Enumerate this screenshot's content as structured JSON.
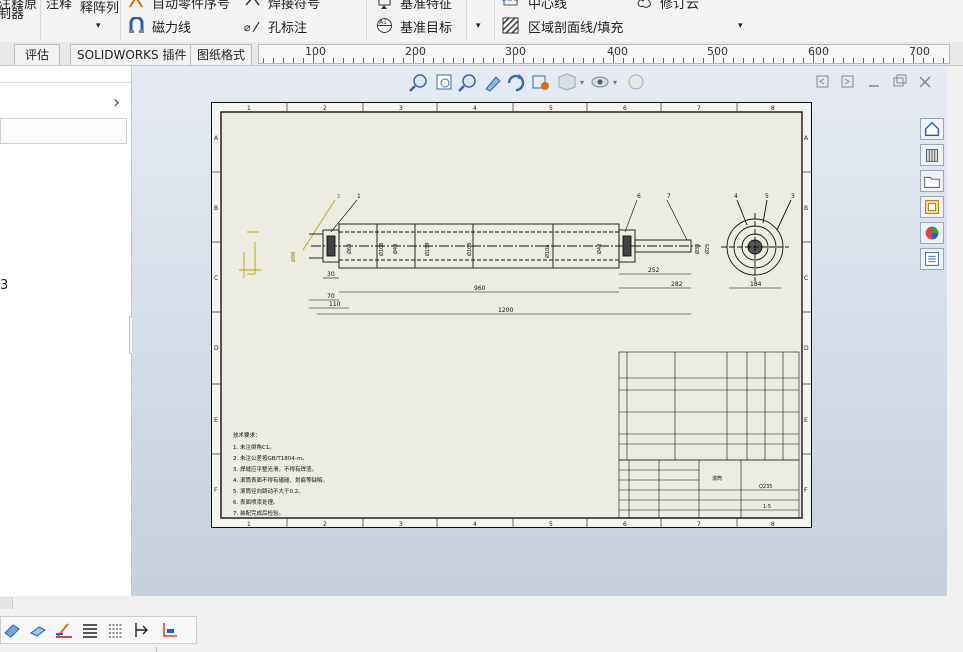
{
  "ribbon": {
    "row1": {
      "c1": "注释原",
      "c2": "注释",
      "c3": "释阵列",
      "c4": "自动零件序号",
      "c5": "焊接符号",
      "c6": "基准特征",
      "c7": "中心线",
      "c8": "修订云"
    },
    "row2": {
      "c1": "制器",
      "c2": "磁力线",
      "c3": "孔标注",
      "c4": "基准目标",
      "c5": "区域剖面线/填充"
    }
  },
  "tabs": [
    "评估",
    "SOLIDWORKS 插件",
    "图纸格式"
  ],
  "ruler": {
    "labels": [
      "100",
      "200",
      "300",
      "400",
      "500",
      "600",
      "700"
    ]
  },
  "left_panel": {
    "chevron": "›",
    "partial_text": "3"
  },
  "drawing": {
    "column_labels": [
      "1",
      "2",
      "3",
      "4",
      "5",
      "6",
      "7",
      "8"
    ],
    "row_labels": [
      "A",
      "B",
      "C",
      "D",
      "E",
      "F"
    ],
    "dims": {
      "d30": "30",
      "d70": "70",
      "d110": "110",
      "d960": "960",
      "d1200": "1200",
      "d252": "252",
      "d282": "282",
      "d184": "184",
      "v1": "Ø60",
      "v2": "Ø108",
      "v3": "Ø48",
      "v4": "Ø159",
      "v5": "Ø108",
      "v6": "Ø108",
      "v7": "Ø48",
      "v8": "Ø30",
      "v9": "Ø25"
    },
    "balloons": [
      "2",
      "1",
      "6",
      "7",
      "4",
      "5",
      "3"
    ],
    "notes_title": "技术要求：",
    "notes": [
      "1. 未注倒角C1。",
      "2. 未注公差按GB/T1804-m。",
      "3. 焊缝应平整光滑，不得有焊渣。",
      "4. 滚筒表面不得有磕碰、划痕等缺陷。",
      "5. 滚筒径向跳动不大于0.2。",
      "6. 表面喷漆处理。",
      "7. 装配完成后检验。"
    ],
    "title_block": {
      "name": "滚筒",
      "material": "Q235",
      "scale": "1:5"
    }
  },
  "view_toolbar": {
    "icons": [
      "zoom-fit-icon",
      "zoom-area-icon",
      "zoom-prev-icon",
      "pan-icon",
      "rotate-icon",
      "view-orient-icon",
      "display-style-icon",
      "hide-show-icon",
      "appearance-icon"
    ]
  },
  "window_controls": [
    "restore-left",
    "restore-right",
    "minimize",
    "maximize",
    "close"
  ]
}
